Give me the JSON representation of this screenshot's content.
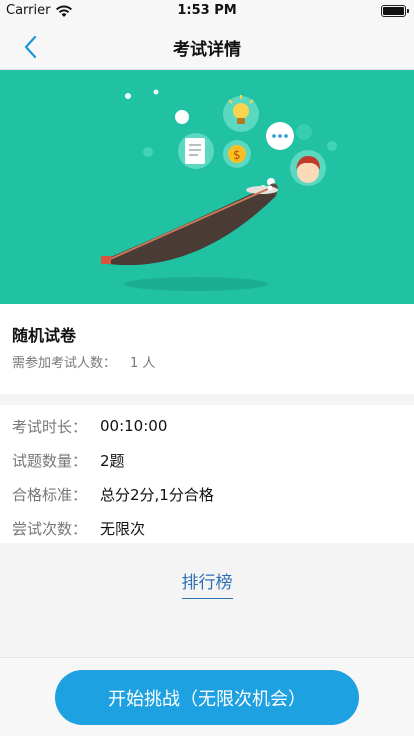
{
  "status_bar": {
    "carrier": "Carrier",
    "time": "1:53 PM"
  },
  "nav": {
    "back_icon": "chevron-left-icon",
    "title": "考试详情"
  },
  "exam": {
    "name": "随机试卷",
    "participants_label": "需参加考试人数：",
    "participants_value": "1 人"
  },
  "details": [
    {
      "label": "考试时长：",
      "value": "00:10:00"
    },
    {
      "label": "试题数量：",
      "value": "2题"
    },
    {
      "label": "合格标准：",
      "value": "总分2分,1分合格"
    },
    {
      "label": "尝试次数：",
      "value": "无限次"
    }
  ],
  "ranking_label": "排行榜",
  "start_button_label": "开始挑战（无限次机会）",
  "colors": {
    "banner": "#21c2a4",
    "primary": "#1ea1e0",
    "link": "#2f6fb8"
  }
}
